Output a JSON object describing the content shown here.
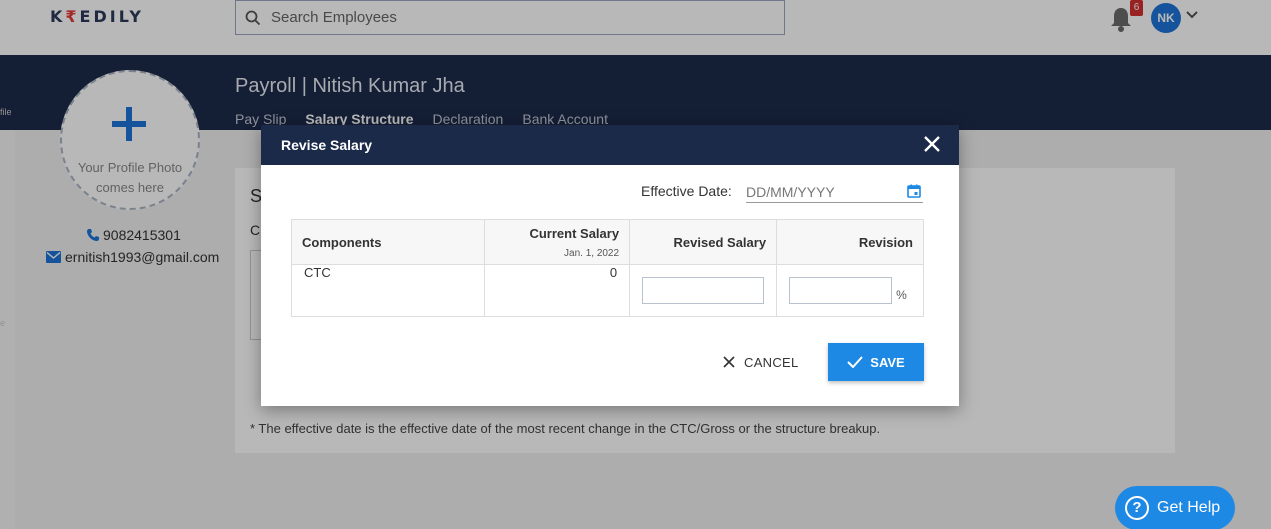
{
  "app": {
    "logo_prefix": "K",
    "logo_rupee": "₹",
    "logo_suffix": "EDILY"
  },
  "search": {
    "placeholder": "Search Employees"
  },
  "notifications": {
    "count": "6"
  },
  "user": {
    "initials": "NK"
  },
  "sidebar": {
    "label_1": "file",
    "label_2": "e"
  },
  "page": {
    "title": "Payroll | Nitish Kumar Jha"
  },
  "tabs": [
    {
      "label": "Pay Slip"
    },
    {
      "label": "Salary Structure"
    },
    {
      "label": "Declaration"
    },
    {
      "label": "Bank Account"
    }
  ],
  "profile": {
    "photo_text": "Your Profile Photo comes here",
    "phone": "9082415301",
    "email": "ernitish1993@gmail.com"
  },
  "card": {
    "title_initial": "S",
    "sub_initial": "C",
    "footnote": "* The effective date is the effective date of the most recent change in the CTC/Gross or the structure breakup."
  },
  "modal": {
    "title": "Revise Salary",
    "effective_date_label": "Effective Date:",
    "effective_date_placeholder": "DD/MM/YYYY",
    "columns": {
      "components": "Components",
      "current_salary": "Current Salary",
      "current_salary_date": "Jan. 1, 2022",
      "revised_salary": "Revised Salary",
      "revision": "Revision"
    },
    "rows": [
      {
        "component": "CTC",
        "current": "0",
        "revised": "",
        "revision": "",
        "unit": "%"
      }
    ],
    "cancel_label": "CANCEL",
    "save_label": "SAVE"
  },
  "help": {
    "label": "Get Help",
    "icon_glyph": "?"
  },
  "colors": {
    "navy": "#1c2a4a",
    "accent": "#1e88e5",
    "badge": "#d32f2f"
  }
}
